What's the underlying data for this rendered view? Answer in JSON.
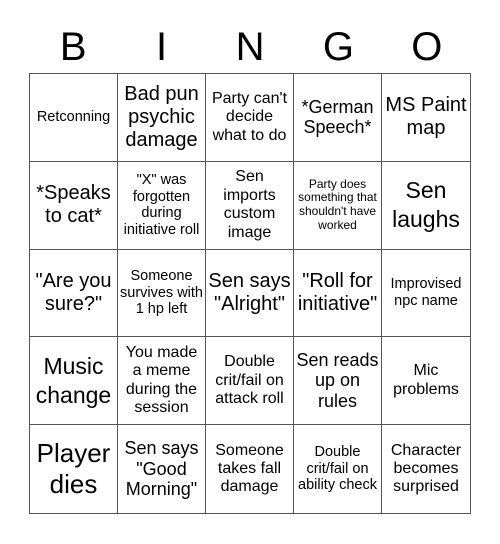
{
  "header": {
    "letters": [
      "B",
      "I",
      "N",
      "G",
      "O"
    ]
  },
  "cells": [
    "Retconning",
    "Bad pun psychic damage",
    "Party can't decide what to do",
    "*German Speech*",
    "MS Paint map",
    "*Speaks to cat*",
    "\"X\" was forgotten during initiative roll",
    "Sen imports custom image",
    "Party does something that shouldn't have worked",
    "Sen laughs",
    "\"Are you sure?\"",
    "Someone survives with 1 hp left",
    "Sen says \"Alright\"",
    "\"Roll for initiative\"",
    "Improvised npc name",
    "Music change",
    "You made a meme during the session",
    "Double crit/fail on attack roll",
    "Sen reads up on rules",
    "Mic problems",
    "Player dies",
    "Sen says \"Good Morning\"",
    "Someone takes fall damage",
    "Double crit/fail on ability check",
    "Character becomes surprised"
  ]
}
